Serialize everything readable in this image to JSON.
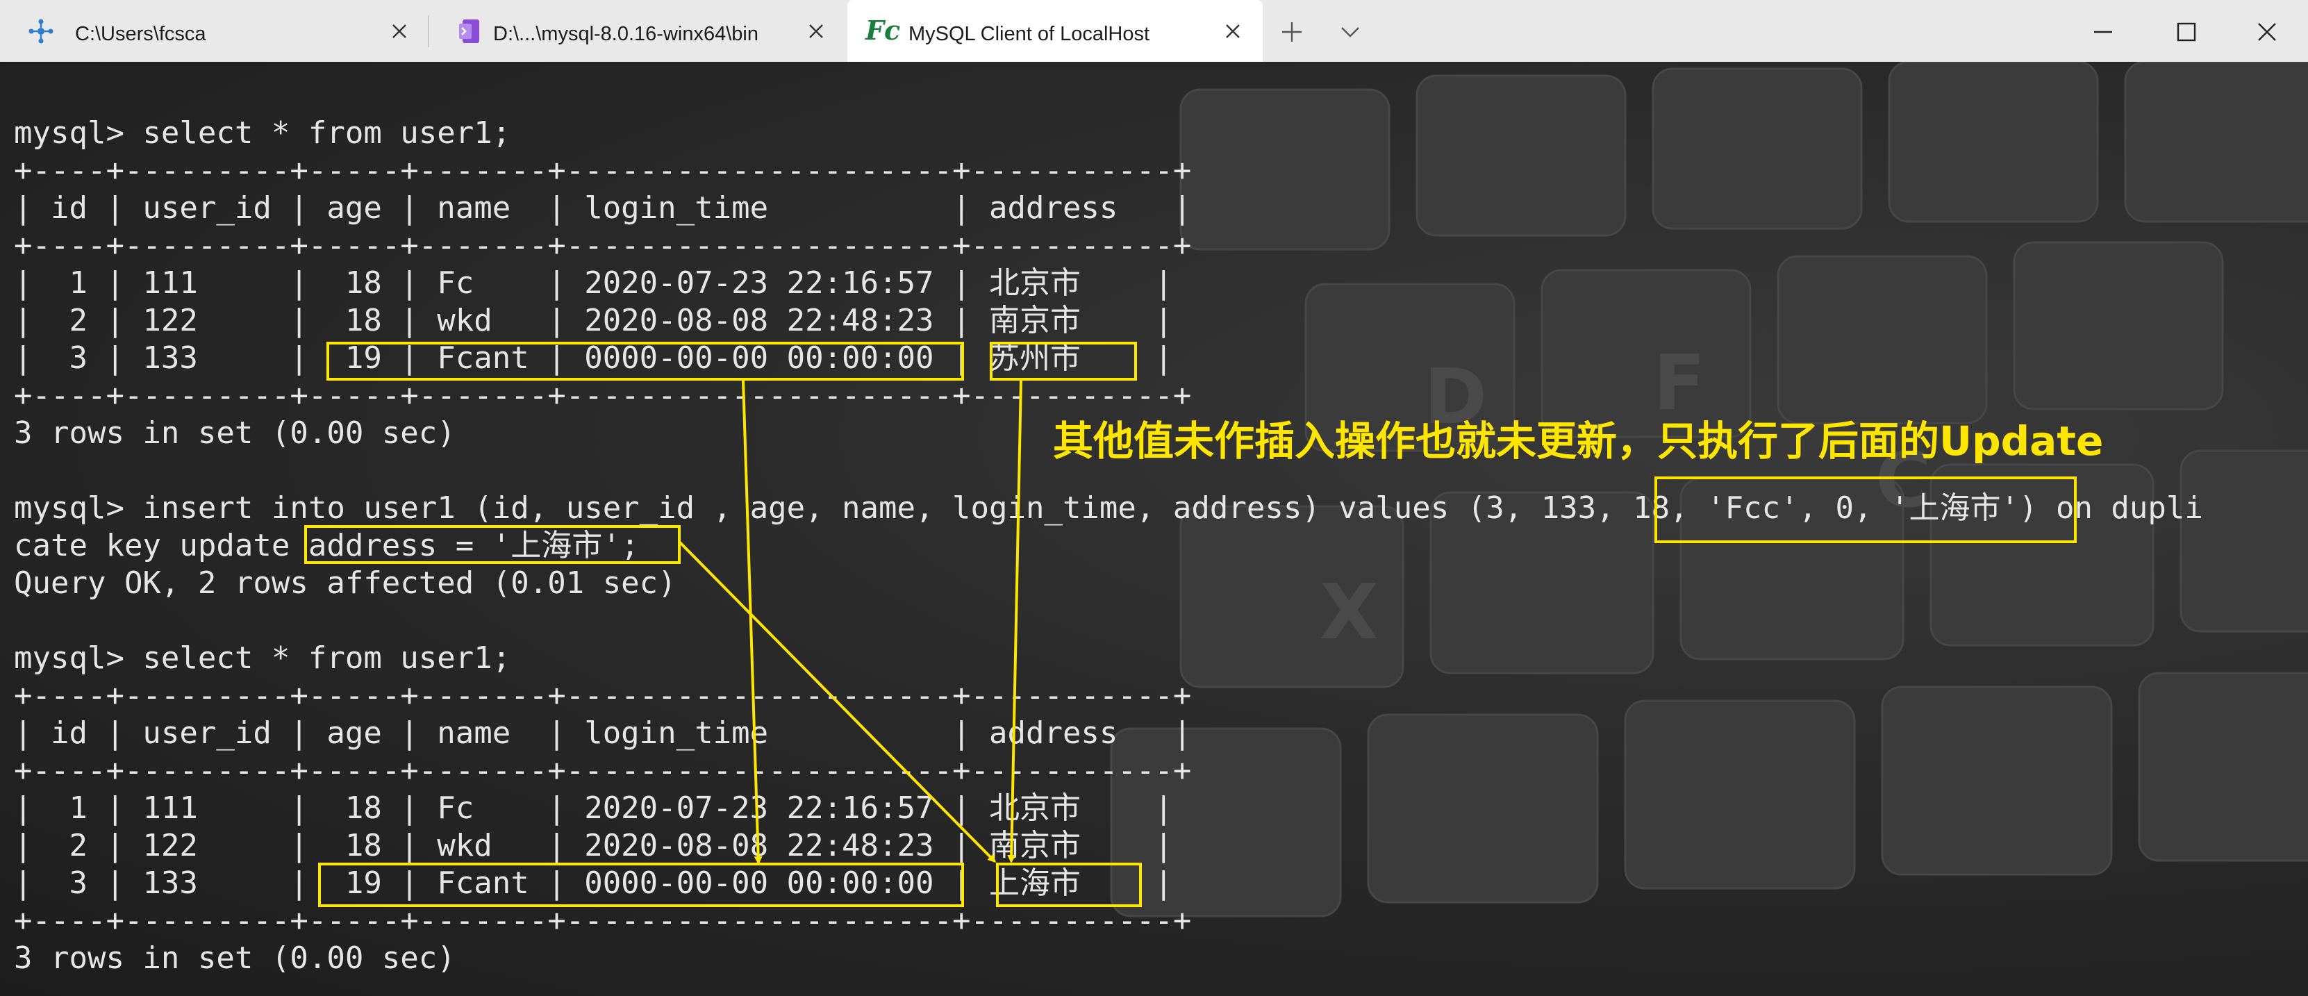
{
  "tabs": [
    {
      "title": "C:\\Users\\fcsca",
      "active": false
    },
    {
      "title": "D:\\...\\mysql-8.0.16-winx64\\bin",
      "active": false
    },
    {
      "title": "MySQL Client of LocalHost",
      "active": true,
      "icon_text": "Fc"
    }
  ],
  "colors": {
    "titlebar": "#e9e9e9",
    "active_tab": "#ffffff",
    "terminal_text": "#e6e6e6",
    "highlight": "#ffe600",
    "fc_icon": "#1a7f3c",
    "cmd_icon": "#2d7dd2",
    "ps_icon": "#8a4bd6"
  },
  "icons": {
    "tab1": "network-hub-icon",
    "tab2": "terminal-window-icon",
    "tab3": "fc-logo-icon",
    "new_tab": "plus-icon",
    "dropdown": "chevron-down-icon",
    "minimize": "minimize-icon",
    "maximize": "maximize-icon",
    "close": "close-icon"
  },
  "terminal": {
    "lines": [
      "mysql> select * from user1;",
      "+----+---------+-----+-------+---------------------+-----------+",
      "| id | user_id | age | name  | login_time          | address   |",
      "+----+---------+-----+-------+---------------------+-----------+",
      "|  1 | 111     |  18 | Fc    | 2020-07-23 22:16:57 | 北京市    |",
      "|  2 | 122     |  18 | wkd   | 2020-08-08 22:48:23 | 南京市    |",
      "|  3 | 133     |  19 | Fcant | 0000-00-00 00:00:00 | 苏州市    |",
      "+----+---------+-----+-------+---------------------+-----------+",
      "3 rows in set (0.00 sec)",
      "",
      "mysql> insert into user1 (id, user_id , age, name, login_time, address) values (3, 133, 18, 'Fcc', 0, '上海市') on dupli",
      "cate key update address = '上海市';",
      "Query OK, 2 rows affected (0.01 sec)",
      "",
      "mysql> select * from user1;",
      "+----+---------+-----+-------+---------------------+-----------+",
      "| id | user_id | age | name  | login_time          | address   |",
      "+----+---------+-----+-------+---------------------+-----------+",
      "|  1 | 111     |  18 | Fc    | 2020-07-23 22:16:57 | 北京市    |",
      "|  2 | 122     |  18 | wkd   | 2020-08-08 22:48:23 | 南京市    |",
      "|  3 | 133     |  19 | Fcant | 0000-00-00 00:00:00 | 上海市    |",
      "+----+---------+-----+-------+---------------------+-----------+",
      "3 rows in set (0.00 sec)"
    ]
  },
  "annotation": {
    "text": "其他值未作插入操作也就未更新，只执行了后面的Update"
  }
}
